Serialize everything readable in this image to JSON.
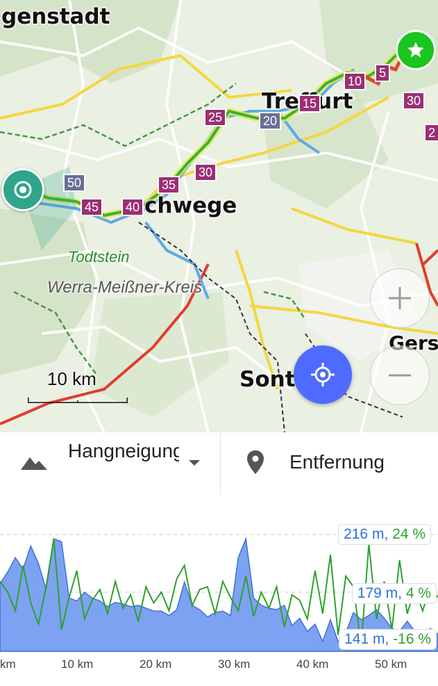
{
  "map": {
    "places": {
      "eisenach_fragment": "genstadt",
      "treffurt": "Treffurt",
      "eschwege": "chwege",
      "sontra": "Sont",
      "gerstungen_fragment": "Gers"
    },
    "nature_label": "Todtstein",
    "district_label": "Werra-Meißner-Kreis",
    "scale_label": "10 km",
    "markers": [
      {
        "text": "10",
        "style": "purple"
      },
      {
        "text": "5",
        "style": "purple"
      },
      {
        "text": "30",
        "style": "purple"
      },
      {
        "text": "25",
        "style": "purple"
      },
      {
        "text": "15",
        "style": "purple"
      },
      {
        "text": "20",
        "style": "slate"
      },
      {
        "text": "2",
        "style": "purple"
      },
      {
        "text": "30",
        "style": "purple"
      },
      {
        "text": "35",
        "style": "purple"
      },
      {
        "text": "50",
        "style": "slate"
      },
      {
        "text": "45",
        "style": "purple"
      },
      {
        "text": "40",
        "style": "purple"
      }
    ],
    "colors": {
      "route": "#38b03a",
      "route_highlight": "#e8e84c",
      "water": "#5da8e8",
      "major_road": "#e23c2c",
      "road_yellow": "#f4d642",
      "locate_button": "#4f6bff"
    }
  },
  "controls": {
    "left_select": {
      "label": "Hangneigung/Höhe",
      "icon": "mountain-icon"
    },
    "right_select": {
      "label": "Entfernung",
      "icon": "location-pin-icon"
    }
  },
  "profile": {
    "badges": [
      {
        "altitude": "216 m,",
        "slope": "24 %"
      },
      {
        "altitude": "179 m,",
        "slope": "4 %"
      },
      {
        "altitude": "141 m,",
        "slope": "-16 %"
      }
    ],
    "x_ticks": [
      "km",
      "10 km",
      "20 km",
      "30 km",
      "40 km",
      "50 km"
    ]
  },
  "chart_data": {
    "type": "area",
    "x_unit": "km",
    "xlim": [
      -1,
      56
    ],
    "series": [
      {
        "values_km": [
          -1,
          0,
          1,
          2,
          3,
          4,
          5,
          6,
          7,
          8,
          9,
          10,
          11,
          12,
          13,
          14,
          15,
          16,
          17,
          18,
          19,
          20,
          21,
          22,
          23,
          24,
          25,
          26,
          27,
          28,
          29,
          30,
          31,
          32,
          33,
          34,
          35,
          36,
          37,
          38,
          39,
          40,
          41,
          42,
          43,
          44,
          45,
          46,
          47,
          48,
          49,
          50,
          51,
          52,
          53,
          54,
          55,
          56
        ],
        "altitude_m": [
          182,
          190,
          200,
          192,
          208,
          196,
          178,
          213,
          211,
          172,
          170,
          176,
          172,
          170,
          166,
          169,
          168,
          166,
          167,
          165,
          163,
          163,
          160,
          164,
          183,
          167,
          164,
          159,
          162,
          163,
          160,
          200,
          213,
          172,
          167,
          165,
          164,
          167,
          153,
          158,
          149,
          154,
          142,
          157,
          142,
          148,
          162,
          157,
          160,
          164,
          158,
          151,
          149,
          156,
          149,
          142,
          151,
          147
        ]
      },
      {
        "slope_pct_sampled": [
          8,
          4,
          -3,
          14,
          0,
          -8,
          6,
          24,
          -10,
          2,
          12,
          -6,
          1,
          5,
          -4,
          8,
          -2,
          3,
          -7,
          6,
          0,
          4,
          -3,
          9,
          14,
          -1,
          5,
          6,
          -4,
          8,
          2,
          -3,
          10,
          -5,
          4,
          -2,
          6,
          -9,
          3,
          1,
          -6,
          12,
          -4,
          18,
          -12,
          10,
          6,
          -16,
          22,
          -6,
          8,
          -10,
          16,
          -4,
          5,
          -3,
          6,
          2
        ]
      }
    ],
    "ylim_altitude": [
      141,
      216
    ],
    "ylim_slope": [
      -16,
      24
    ]
  }
}
